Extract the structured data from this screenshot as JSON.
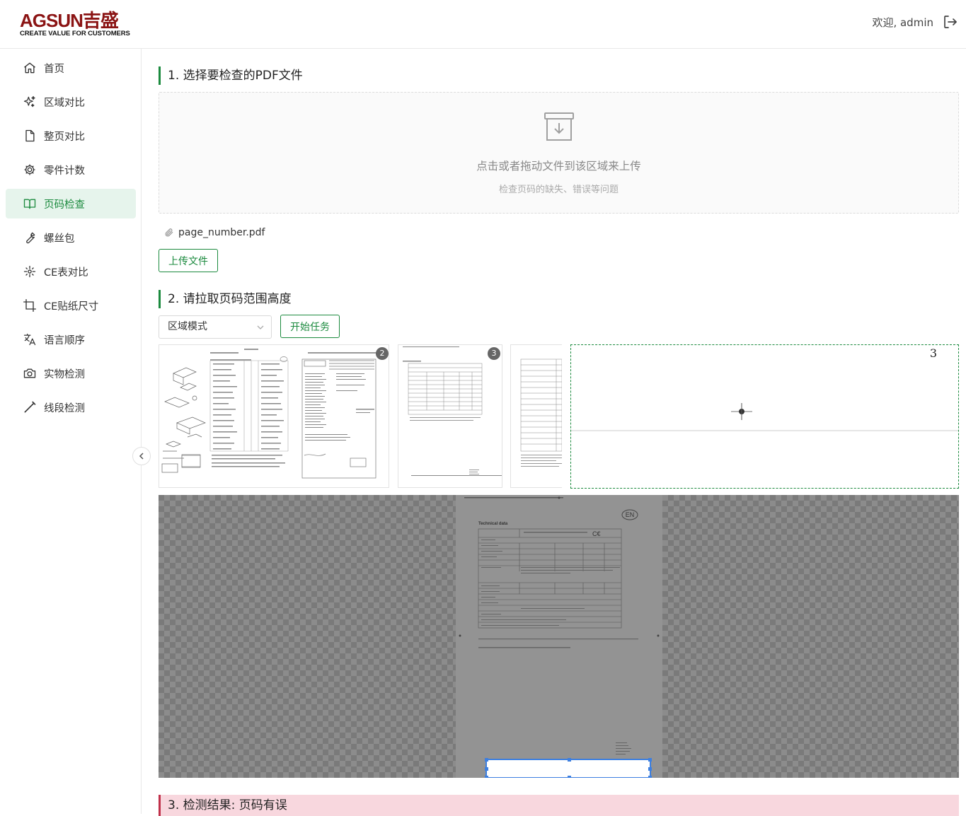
{
  "header": {
    "logo_main": "AGSUN吉盛",
    "logo_sub": "CREATE VALUE FOR CUSTOMERS",
    "welcome": "欢迎, admin"
  },
  "sidebar": {
    "items": [
      {
        "label": "首页",
        "icon": "home-icon"
      },
      {
        "label": "区域对比",
        "icon": "sparkles-icon"
      },
      {
        "label": "整页对比",
        "icon": "document-icon"
      },
      {
        "label": "零件计数",
        "icon": "gear-icon"
      },
      {
        "label": "页码检查",
        "icon": "book-icon",
        "active": true
      },
      {
        "label": "螺丝包",
        "icon": "wrench-icon"
      },
      {
        "label": "CE表对比",
        "icon": "focus-icon"
      },
      {
        "label": "CE贴纸尺寸",
        "icon": "crop-icon"
      },
      {
        "label": "语言顺序",
        "icon": "translate-icon"
      },
      {
        "label": "实物检测",
        "icon": "camera-icon"
      },
      {
        "label": "线段检测",
        "icon": "pen-icon"
      }
    ]
  },
  "step1": {
    "title": "1. 选择要检查的PDF文件",
    "dropzone_main": "点击或者拖动文件到该区域来上传",
    "dropzone_sub": "检查页码的缺失、错误等问题",
    "file_name": "page_number.pdf",
    "upload_button": "上传文件"
  },
  "step2": {
    "title": "2. 请拉取页码范围高度",
    "mode_select": "区域模式",
    "start_button": "开始任务",
    "thumb_badges": [
      "2",
      "3"
    ],
    "preview_page_number": "3",
    "page_label_en": "EN",
    "page_heading": "Technical data"
  },
  "step3": {
    "title": "3. 检测结果: 页码有误"
  },
  "colors": {
    "accent": "#1b8a3e",
    "accent_bg": "#e6f4ec",
    "error_bg": "#f8d7de",
    "brand": "#8b1414",
    "selection": "#3d7fe0"
  }
}
